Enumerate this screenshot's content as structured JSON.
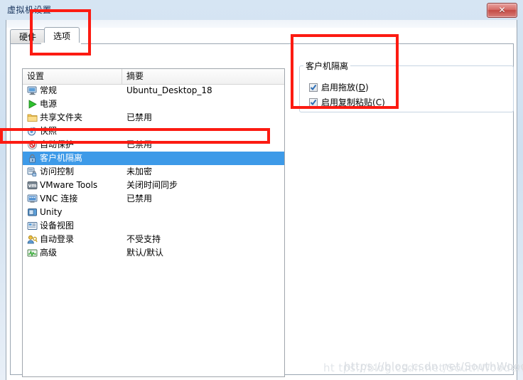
{
  "window": {
    "title": "虚拟机设置",
    "close_label": "✕",
    "close_icon": "close-icon"
  },
  "tabs": [
    {
      "label": "硬件",
      "active": false
    },
    {
      "label": "选项",
      "active": true
    }
  ],
  "list": {
    "columns": [
      "设置",
      "摘要"
    ],
    "rows": [
      {
        "icon": "monitor-icon",
        "label": "常规",
        "summary": "Ubuntu_Desktop_18",
        "selected": false
      },
      {
        "icon": "play-icon",
        "label": "电源",
        "summary": "",
        "selected": false
      },
      {
        "icon": "folder-icon",
        "label": "共享文件夹",
        "summary": "已禁用",
        "selected": false
      },
      {
        "icon": "camera-icon",
        "label": "快照",
        "summary": "",
        "selected": false
      },
      {
        "icon": "shield-icon",
        "label": "自动保护",
        "summary": "已禁用",
        "selected": false
      },
      {
        "icon": "lock-icon",
        "label": "客户机隔离",
        "summary": "",
        "selected": true
      },
      {
        "icon": "access-lock-icon",
        "label": "访问控制",
        "summary": "未加密",
        "selected": false
      },
      {
        "icon": "vmware-tools-icon",
        "label": "VMware Tools",
        "summary": "关闭时间同步",
        "selected": false
      },
      {
        "icon": "vnc-monitor-icon",
        "label": "VNC 连接",
        "summary": "已禁用",
        "selected": false
      },
      {
        "icon": "unity-icon",
        "label": "Unity",
        "summary": "",
        "selected": false
      },
      {
        "icon": "device-view-icon",
        "label": "设备视图",
        "summary": "",
        "selected": false
      },
      {
        "icon": "autologin-icon",
        "label": "自动登录",
        "summary": "不受支持",
        "selected": false
      },
      {
        "icon": "advanced-icon",
        "label": "高级",
        "summary": "默认/默认",
        "selected": false
      }
    ]
  },
  "panel": {
    "group_title": "客户机隔离",
    "checkboxes": [
      {
        "label_main": "启用拖放(",
        "mnemonic": "D",
        "label_end": ")",
        "checked": true
      },
      {
        "label_main": "启用复制粘贴(",
        "mnemonic": "C",
        "label_end": ")",
        "checked": true
      }
    ]
  },
  "annotations": {
    "color": "#fc1b12",
    "boxes": [
      "tab-options-highlight",
      "selected-row-highlight",
      "isolation-panel-highlight"
    ]
  },
  "watermark": {
    "main": "https://blog.csdn.net/SouthWooden",
    "ghost": "ht tps://blog.csdn.net/SouthWooden"
  }
}
